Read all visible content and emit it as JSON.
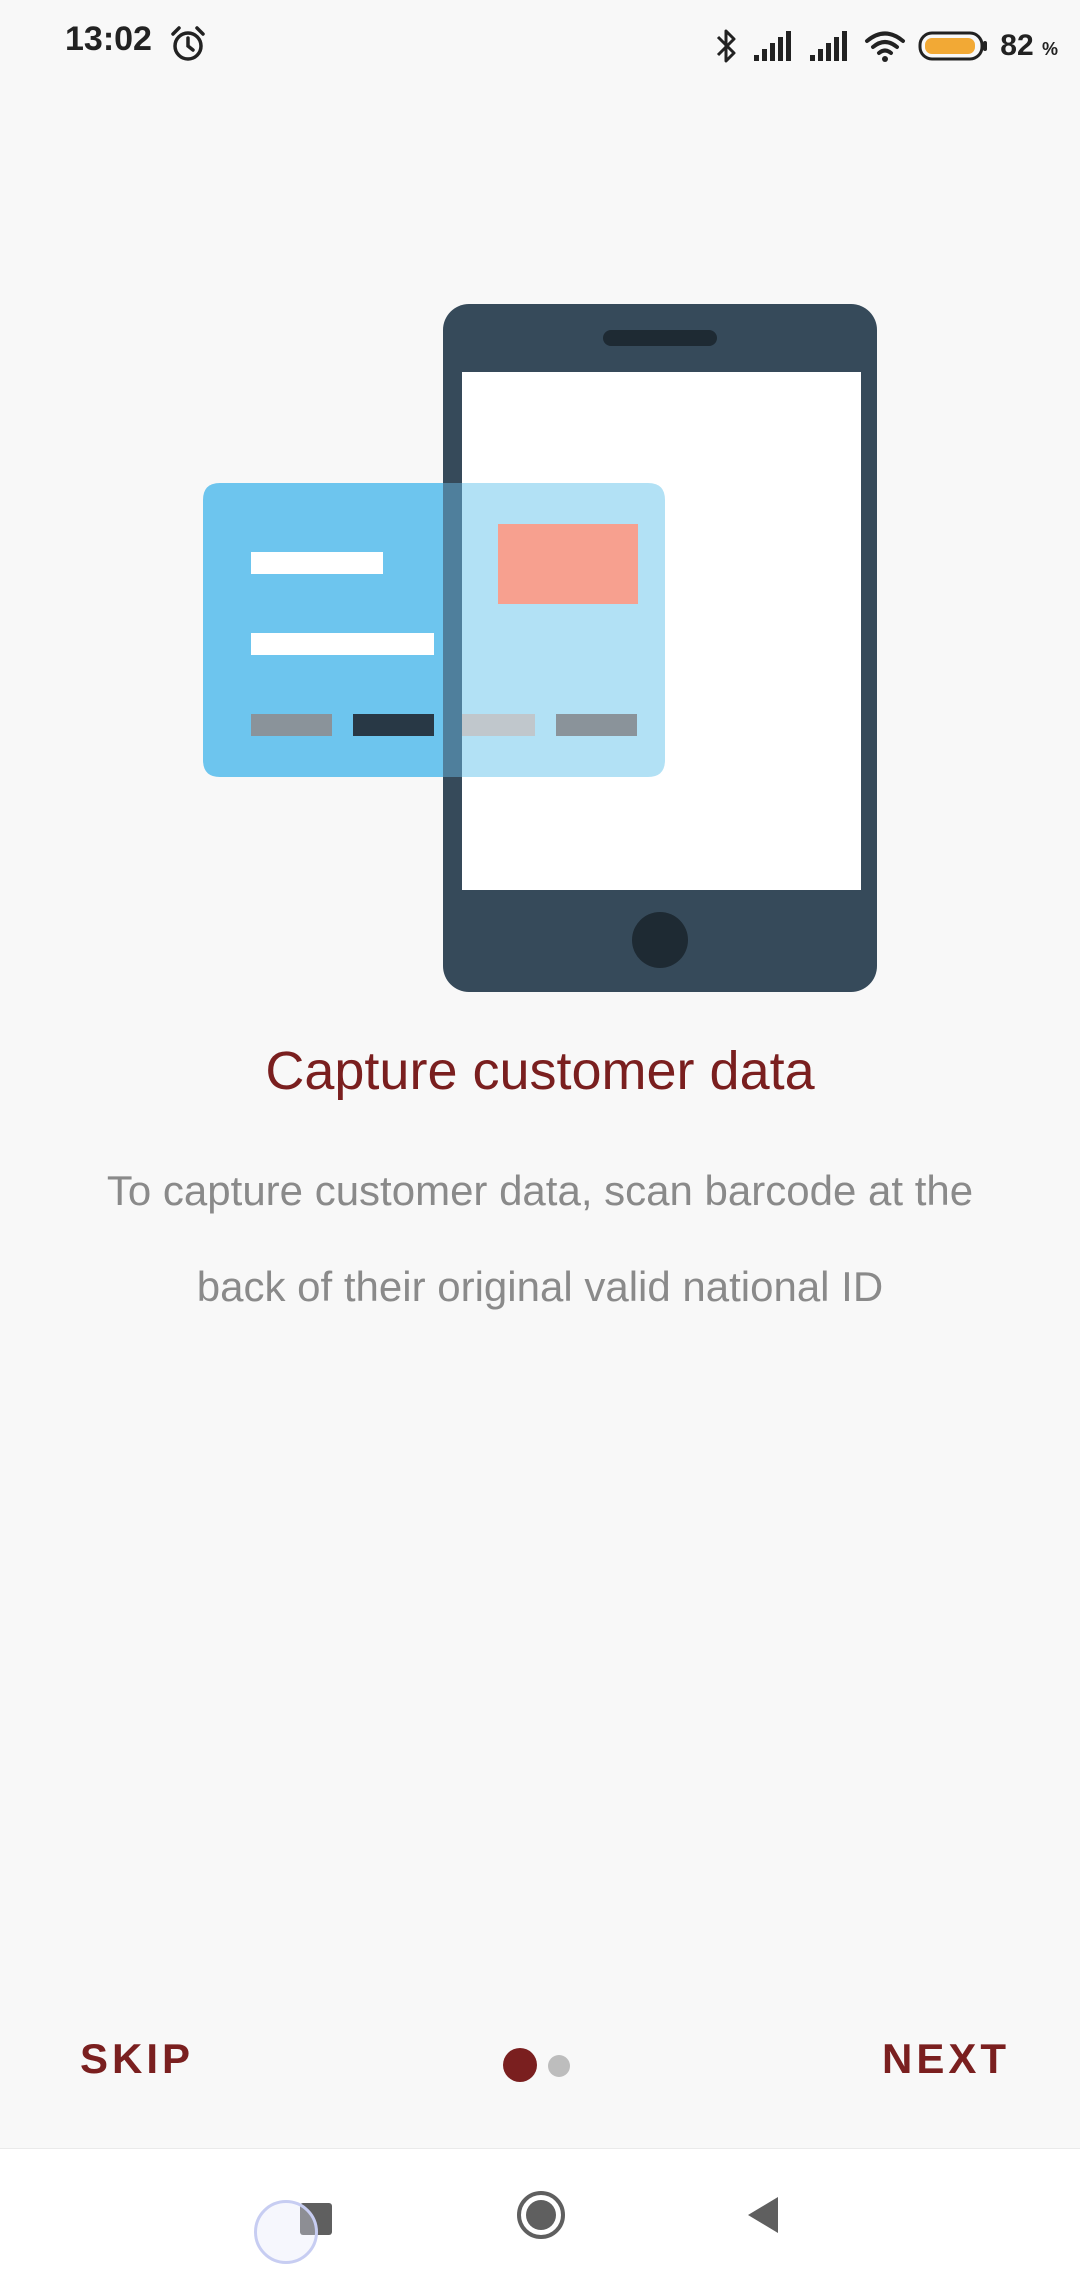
{
  "status_bar": {
    "time": "13:02",
    "battery_percent": "82",
    "battery_unit": "%",
    "icons": [
      "alarm-icon",
      "bluetooth-icon",
      "signal-icon",
      "signal-icon",
      "wifi-icon",
      "battery-icon"
    ]
  },
  "onboarding": {
    "title": "Capture customer data",
    "description": "To capture customer data, scan barcode at the back of their original valid national ID",
    "skip_label": "SKIP",
    "next_label": "NEXT",
    "current_page": 1,
    "total_pages": 2
  },
  "illustration": {
    "name": "phone-scanning-id-card",
    "colors": {
      "phone_body": "#364a5a",
      "card": "#6dc5ee",
      "card_overlap": "#b2e1f5",
      "chip": "#f7a08f"
    }
  },
  "colors": {
    "accent": "#7a1f1f",
    "background": "#f8f8f8",
    "description_text": "#8a8a8a"
  },
  "system_nav": {
    "icons": [
      "recents-icon",
      "home-icon",
      "back-icon"
    ]
  }
}
